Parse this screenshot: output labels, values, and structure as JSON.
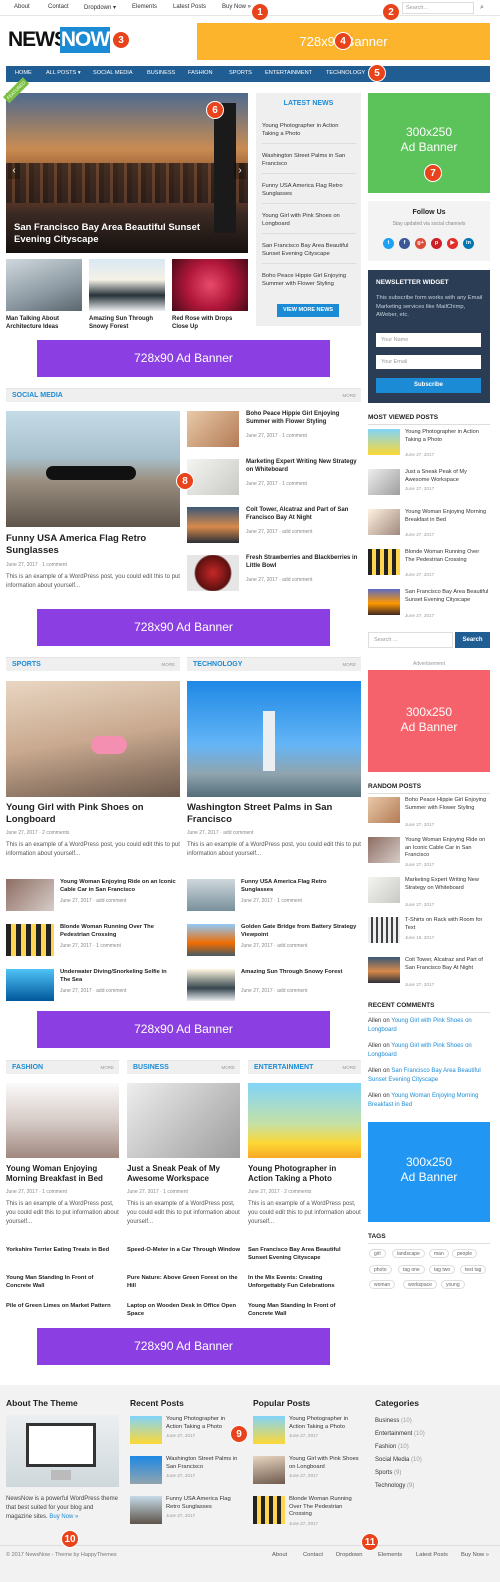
{
  "topbar": {
    "items": [
      "About",
      "Contact",
      "Dropdown ▾",
      "Elements",
      "Latest Posts",
      "Buy Now »"
    ],
    "search_placeholder": "Search...",
    "search_icon": "search-icon"
  },
  "logo": {
    "part1": "NEWS",
    "part2": "NOW"
  },
  "banner_top": "728x90 Banner",
  "mainnav": [
    "HOME",
    "ALL POSTS ▾",
    "SOCIAL MEDIA",
    "BUSINESS",
    "FASHION",
    "SPORTS",
    "ENTERTAINMENT",
    "TECHNOLOGY"
  ],
  "slider": {
    "featured": "FEATURED",
    "title": "San Francisco Bay Area Beautiful Sunset Evening Cityscape",
    "thumbs": [
      "Man Talking About Architecture Ideas",
      "Amazing Sun Through Snowy Forest",
      "Red Rose with Drops Close Up"
    ]
  },
  "latest": {
    "title": "LATEST NEWS",
    "items": [
      "Young Photographer in Action Taking a Photo",
      "Washington Street Palms in San Francisco",
      "Funny USA America Flag Retro Sunglasses",
      "Young Girl with Pink Shoes on Longboard",
      "San Francisco Bay Area Beautiful Sunset Evening Cityscape",
      "Boho Peace Hippie Girl Enjoying Summer with Flower Styling"
    ],
    "button": "VIEW MORE NEWS"
  },
  "ad728": "728x90 Ad Banner",
  "ad300": {
    "line1": "300x250",
    "line2": "Ad Banner"
  },
  "more": "MORE",
  "social_media": {
    "title": "SOCIAL MEDIA",
    "main_title": "Funny USA America Flag Retro Sunglasses",
    "main_date": "June 27, 2017",
    "main_comments": "1 comment",
    "excerpt": "This is an example of a WordPress post, you could edit this to put information about yourself...",
    "posts": [
      {
        "title": "Boho Peace Hippie Girl Enjoying Summer with Flower Styling",
        "date": "June 27, 2017",
        "comments": "1 comment"
      },
      {
        "title": "Marketing Expert Writing New Strategy on Whiteboard",
        "date": "June 27, 2017",
        "comments": "1 comment"
      },
      {
        "title": "Coit Tower, Alcatraz and Part of San Francisco Bay At Night",
        "date": "June 27, 2017",
        "comments": "add comment"
      },
      {
        "title": "Fresh Strawberries and Blackberries in Little Bowl",
        "date": "June 27, 2017",
        "comments": "add comment"
      }
    ]
  },
  "sports": {
    "title": "SPORTS",
    "main_title": "Young Girl with Pink Shoes on Longboard",
    "main_date": "June 27, 2017",
    "main_comments": "2 comments",
    "excerpt": "This is an example of a WordPress post, you could edit this to put information about yourself...",
    "posts": [
      {
        "title": "Young Woman Enjoying Ride on an Iconic Cable Car in San Francisco",
        "date": "June 27, 2017",
        "comments": "add comment"
      },
      {
        "title": "Blonde Woman Running Over The Pedestrian Crossing",
        "date": "June 27, 2017",
        "comments": "1 comment"
      },
      {
        "title": "Underwater Diving/Snorkeling Selfie in The Sea",
        "date": "June 27, 2017",
        "comments": "add comment"
      }
    ]
  },
  "technology": {
    "title": "TECHNOLOGY",
    "main_title": "Washington Street Palms in San Francisco",
    "main_date": "June 27, 2017",
    "main_comments": "add comment",
    "excerpt": "This is an example of a WordPress post, you could edit this to put information about yourself...",
    "posts": [
      {
        "title": "Funny USA America Flag Retro Sunglasses",
        "date": "June 27, 2017",
        "comments": "1 comment"
      },
      {
        "title": "Golden Gate Bridge from Battery Strategy Viewpoint",
        "date": "June 27, 2017",
        "comments": "add comment"
      },
      {
        "title": "Amazing Sun Through Snowy Forest",
        "date": "June 27, 2017",
        "comments": "add comment"
      }
    ]
  },
  "fashion": {
    "title": "FASHION",
    "main_title": "Young Woman Enjoying Morning Breakfast in Bed",
    "main_date": "June 27, 2017",
    "main_comments": "1 comment",
    "excerpt": "This is an example of a WordPress post, you could edit this to put information about yourself...",
    "posts": [
      "Yorkshire Terrier Eating Treats in Bed",
      "Young Man Standing In Front of Concrete Wall",
      "Pile of Green Limes on Market Pattern"
    ]
  },
  "business": {
    "title": "BUSINESS",
    "main_title": "Just a Sneak Peak of My Awesome Workspace",
    "main_date": "June 27, 2017",
    "main_comments": "1 comment",
    "excerpt": "This is an example of a WordPress post, you could edit this to put information about yourself...",
    "posts": [
      "Speed-O-Meter in a Car Through Window",
      "Pure Nature: Above Green Forest on the Hill",
      "Laptop on Wooden Desk in Office Open Space"
    ]
  },
  "entertainment": {
    "title": "ENTERTAINMENT",
    "main_title": "Young Photographer in Action Taking a Photo",
    "main_date": "June 27, 2017",
    "main_comments": "2 comments",
    "excerpt": "This is an example of a WordPress post, you could edit this to put information about yourself...",
    "posts": [
      "San Francisco Bay Area Beautiful Sunset Evening Cityscape",
      "In the Mix Events: Creating Unforgettably Fun Celebrations",
      "Young Man Standing In Front of Concrete Wall"
    ]
  },
  "sidebar": {
    "follow_title": "Follow Us",
    "follow_sub": "Stay updated via social channels",
    "social": [
      "t",
      "f",
      "g+",
      "p",
      "▶",
      "in"
    ],
    "newsletter": {
      "title": "NEWSLETTER WIDGET",
      "text": "This subscribe form works with any Email Marketing services like MailChimp, AWeber, etc.",
      "name_ph": "Your Name",
      "email_ph": "Your Email",
      "button": "Subscribe"
    },
    "most_viewed_title": "MOST VIEWED POSTS",
    "most_viewed": [
      {
        "title": "Young Photographer in Action Taking a Photo",
        "date": "June 27, 2017"
      },
      {
        "title": "Just a Sneak Peak of My Awesome Workspace",
        "date": "June 27, 2017"
      },
      {
        "title": "Young Woman Enjoying Morning Breakfast in Bed",
        "date": "June 27, 2017"
      },
      {
        "title": "Blonde Woman Running Over The Pedestrian Crossing",
        "date": "June 27, 2017"
      },
      {
        "title": "San Francisco Bay Area Beautiful Sunset Evening Cityscape",
        "date": "June 27, 2017"
      }
    ],
    "search_ph": "Search ...",
    "search_btn": "Search",
    "advertisement": "Advertisement",
    "random_title": "RANDOM POSTS",
    "random": [
      {
        "title": "Boho Peace Hippie Girl Enjoying Summer with Flower Styling",
        "date": "June 27, 2017"
      },
      {
        "title": "Young Woman Enjoying Ride on an Iconic Cable Car in San Francisco",
        "date": "June 27, 2017"
      },
      {
        "title": "Marketing Expert Writing New Strategy on Whiteboard",
        "date": "June 27, 2017"
      },
      {
        "title": "T-Shirts on Rack with Room for Text",
        "date": "June 16, 2017"
      },
      {
        "title": "Coit Tower, Alcatraz and Part of San Francisco Bay At Night",
        "date": "June 27, 2017"
      }
    ],
    "comments_title": "RECENT COMMENTS",
    "comments": [
      {
        "author": "Allen",
        "on": "on",
        "post": "Young Girl with Pink Shoes on Longboard"
      },
      {
        "author": "Allen",
        "on": "on",
        "post": "Young Girl with Pink Shoes on Longboard"
      },
      {
        "author": "Allen",
        "on": "on",
        "post": "San Francisco Bay Area Beautiful Sunset Evening Cityscape"
      },
      {
        "author": "Allen",
        "on": "on",
        "post": "Young Woman Enjoying Morning Breakfast in Bed"
      }
    ],
    "tags_title": "TAGS",
    "tags": [
      "girl",
      "landscape",
      "man",
      "people",
      "photo",
      "tag one",
      "tag two",
      "test tag",
      "woman",
      "workspace",
      "young"
    ]
  },
  "footer": {
    "about_title": "About The Theme",
    "about_text": "NewsNow is a powerful WordPress theme that best suited for your blog and magazine sites.",
    "buy": "Buy Now »",
    "recent_title": "Recent Posts",
    "recent": [
      {
        "title": "Young Photographer in Action Taking a Photo",
        "date": "June 27, 2017"
      },
      {
        "title": "Washington Street Palms in San Francisco",
        "date": "June 27, 2017"
      },
      {
        "title": "Funny USA America Flag Retro Sunglasses",
        "date": "June 27, 2017"
      }
    ],
    "popular_title": "Popular Posts",
    "popular": [
      {
        "title": "Young Photographer in Action Taking a Photo",
        "date": "June 27, 2017"
      },
      {
        "title": "Young Girl with Pink Shoes on Longboard",
        "date": "June 27, 2017"
      },
      {
        "title": "Blonde Woman Running Over The Pedestrian Crossing",
        "date": "June 27, 2017"
      }
    ],
    "categories_title": "Categories",
    "categories": [
      {
        "name": "Business",
        "count": "(10)"
      },
      {
        "name": "Entertainment",
        "count": "(10)"
      },
      {
        "name": "Fashion",
        "count": "(10)"
      },
      {
        "name": "Social Media",
        "count": "(10)"
      },
      {
        "name": "Sports",
        "count": "(9)"
      },
      {
        "name": "Technology",
        "count": "(9)"
      }
    ],
    "copyright": "© 2017 NewsNow - Theme by HappyThemes",
    "nav": [
      "About",
      "Contact",
      "Dropdown",
      "Elements",
      "Latest Posts",
      "Buy Now »"
    ]
  },
  "markers": [
    "1",
    "2",
    "3",
    "4",
    "5",
    "6",
    "7",
    "8",
    "9",
    "10",
    "11"
  ],
  "colors": {
    "accent": "#1c8bd5",
    "nav": "#1f5d93",
    "ad_purple": "#8b3ee2",
    "ad_orange": "#fbb42c",
    "ad_green": "#5cc35a",
    "ad_red": "#f5626b",
    "ad_blue": "#2196f3",
    "marker": "#e8431b"
  }
}
